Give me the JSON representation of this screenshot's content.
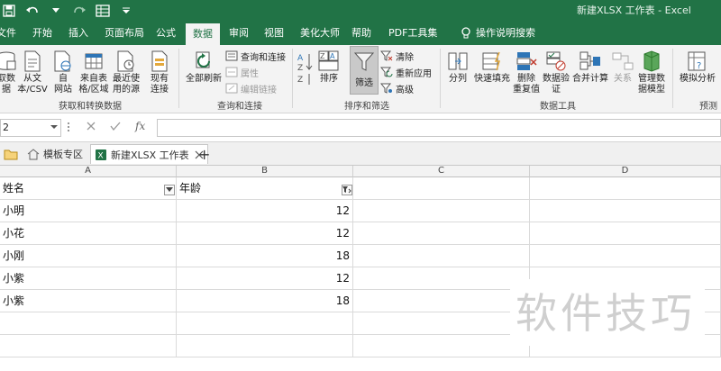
{
  "window": {
    "title": "新建XLSX 工作表 - Excel"
  },
  "menu": {
    "tabs": [
      "文件",
      "开始",
      "插入",
      "页面布局",
      "公式",
      "数据",
      "审阅",
      "视图",
      "美化大师",
      "帮助",
      "PDF工具集"
    ],
    "active_tab": "数据",
    "tell_me": "操作说明搜索"
  },
  "ribbon": {
    "groups": {
      "get_transform": {
        "label": "获取和转换数据",
        "buttons": [
          "获取数据",
          "从文本/CSV",
          "自网站",
          "来自表格/区域",
          "最近使用的源",
          "现有连接"
        ]
      },
      "queries": {
        "label": "查询和连接",
        "refresh_all": "全部刷新",
        "small": [
          "查询和连接",
          "属性",
          "编辑链接"
        ]
      },
      "sort_filter": {
        "label": "排序和筛选",
        "sort": "排序",
        "filter": "筛选",
        "small": [
          "清除",
          "重新应用",
          "高级"
        ]
      },
      "data_tools": {
        "label": "数据工具",
        "buttons": [
          "分列",
          "快速填充",
          "删除重复值",
          "数据验证",
          "合并计算",
          "关系",
          "管理数据模型"
        ]
      },
      "forecast": {
        "label": "预测",
        "buttons": [
          "模拟分析"
        ]
      }
    },
    "btn_lines": {
      "getdata": [
        "取数",
        "据"
      ],
      "fromtext": [
        "从文",
        "本/CSV"
      ],
      "fromweb": [
        "自",
        "网站"
      ],
      "fromtable": [
        "来自表",
        "格/区域"
      ],
      "recent": [
        "最近使",
        "用的源"
      ],
      "existing": [
        "现有",
        "连接"
      ],
      "remove_dup": [
        "删除",
        "重复值"
      ],
      "validate": [
        "数据验",
        "证"
      ],
      "manage_model": [
        "管理数",
        "据模型"
      ]
    }
  },
  "formula_bar": {
    "name_box": "2",
    "fx": "fx",
    "value": ""
  },
  "workbook_tabs": {
    "items": [
      "模板专区",
      "新建XLSX 工作表"
    ],
    "add": "+"
  },
  "sheet": {
    "columns": [
      "A",
      "B",
      "C",
      "D"
    ],
    "rows": [
      [
        "姓名",
        "年龄"
      ],
      [
        "小明",
        "12"
      ],
      [
        "小花",
        "12"
      ],
      [
        "小刚",
        "18"
      ],
      [
        "小紫",
        "12"
      ],
      [
        "小紫",
        "18"
      ]
    ]
  },
  "watermark": "软件技巧",
  "colors": {
    "accent": "#217346",
    "ribbon_bg": "#f3f3f3"
  }
}
